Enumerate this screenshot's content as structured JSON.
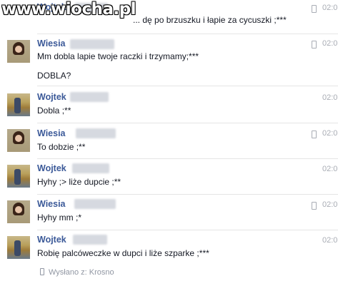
{
  "watermark": "www.wiocha.pl",
  "messages": [
    {
      "sender": "Wojtek",
      "lines": [
        "... dę po brzuszku i łapie za cycuszki ;***"
      ],
      "time": "02:0"
    },
    {
      "sender": "Wiesia",
      "lines": [
        "Mm dobla lapie twoje raczki i trzymamy;***",
        "DOBLA?"
      ],
      "time": "02:0"
    },
    {
      "sender": "Wojtek",
      "lines": [
        "Dobla ;**"
      ],
      "time": "02:0"
    },
    {
      "sender": "Wiesia",
      "lines": [
        "To dobzie ;**"
      ],
      "time": "02:0"
    },
    {
      "sender": "Wojtek",
      "lines": [
        "Hyhy ;> liże dupcie ;**"
      ],
      "time": "02:0"
    },
    {
      "sender": "Wiesia",
      "lines": [
        "Hyhy mm ;*"
      ],
      "time": "02:0"
    },
    {
      "sender": "Wojtek",
      "lines": [
        "Robię palcóweczke w dupci i liże szparke ;***"
      ],
      "time": "02:0"
    }
  ],
  "footer": {
    "sent_from": "Wysłano z: Krosno"
  },
  "icons": {
    "sent_from_mobile": "phone-icon",
    "mobile_indicator": "phone-icon"
  }
}
